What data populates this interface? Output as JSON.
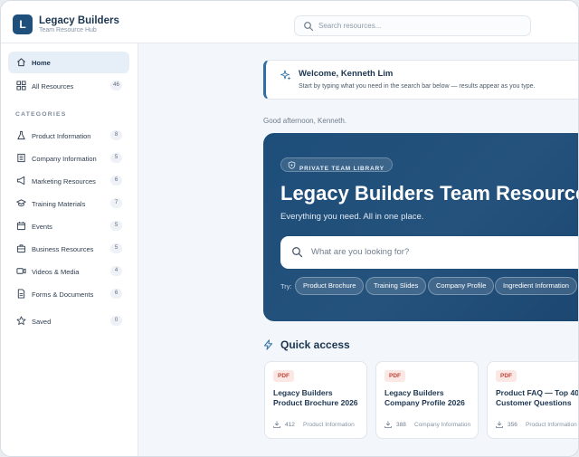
{
  "app": {
    "logo_letter": "L",
    "title": "Legacy Builders",
    "subtitle": "Team Resource Hub",
    "search_placeholder": "Search resources..."
  },
  "sidebar": {
    "home_label": "Home",
    "all_resources": {
      "label": "All Resources",
      "count": "46"
    },
    "categories_heading": "CATEGORIES",
    "categories": [
      {
        "label": "Product Information",
        "count": "8",
        "icon": "flask-icon"
      },
      {
        "label": "Company Information",
        "count": "5",
        "icon": "building-icon"
      },
      {
        "label": "Marketing Resources",
        "count": "6",
        "icon": "megaphone-icon"
      },
      {
        "label": "Training Materials",
        "count": "7",
        "icon": "mortarboard-icon"
      },
      {
        "label": "Events",
        "count": "5",
        "icon": "calendar-icon"
      },
      {
        "label": "Business Resources",
        "count": "5",
        "icon": "briefcase-icon"
      },
      {
        "label": "Videos & Media",
        "count": "4",
        "icon": "video-icon"
      },
      {
        "label": "Forms & Documents",
        "count": "6",
        "icon": "document-icon"
      }
    ],
    "saved": {
      "label": "Saved",
      "count": "0"
    }
  },
  "welcome": {
    "title": "Welcome, Kenneth Lim",
    "subtitle": "Start by typing what you need in the search bar below — results appear as you type."
  },
  "greeting": "Good afternoon, Kenneth.",
  "hero": {
    "badge": "PRIVATE TEAM LIBRARY",
    "title": "Legacy Builders Team Resources",
    "subtitle": "Everything you need. All in one place.",
    "search_placeholder": "What are you looking for?",
    "try_label": "Try:",
    "chips": [
      "Product Brochure",
      "Training Slides",
      "Company Profile",
      "Ingredient Information"
    ]
  },
  "quick_access": {
    "title": "Quick access",
    "cards": [
      {
        "type": "PDF",
        "title": "Legacy Builders Product Brochure 2026",
        "downloads": "412",
        "category": "Product Information"
      },
      {
        "type": "PDF",
        "title": "Legacy Builders Company Profile 2026",
        "downloads": "388",
        "category": "Company Information"
      },
      {
        "type": "PDF",
        "title": "Product FAQ — Top 40 Customer Questions",
        "downloads": "356",
        "category": "Product Information"
      }
    ]
  },
  "colors": {
    "brand": "#1f4f7b",
    "hero": "#1d4e79",
    "pdf_badge": "#c0453a"
  }
}
